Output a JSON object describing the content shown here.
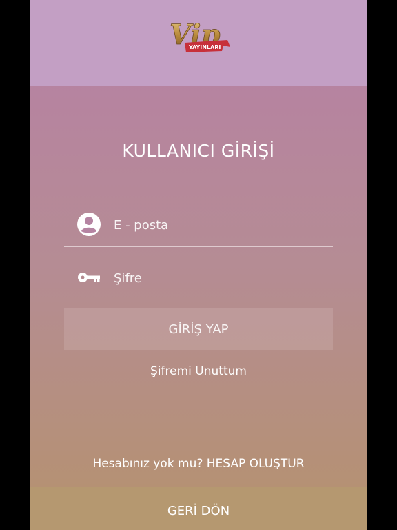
{
  "header": {
    "logo_icon": "vip-yayinlari-logo",
    "logo_text_main": "Vip",
    "logo_text_sub": "YAYINLARI"
  },
  "login": {
    "title": "KULLANICI GİRİŞİ",
    "email_placeholder": "E - posta",
    "email_icon": "user-circle-icon",
    "password_placeholder": "Şifre",
    "password_icon": "key-icon",
    "submit_label": "GİRİŞ YAP",
    "forgot_label": "Şifremi Unuttum",
    "signup_label": "Hesabınız yok mu? HESAP OLUŞTUR",
    "back_label": "GERİ DÖN"
  },
  "colors": {
    "header_bg": "#c39fc4",
    "gradient_top": "#b77fa6",
    "gradient_bottom": "#b5926e",
    "logo_gold": "#c9a45a",
    "logo_red": "#c7303a",
    "text": "#ffffff"
  }
}
